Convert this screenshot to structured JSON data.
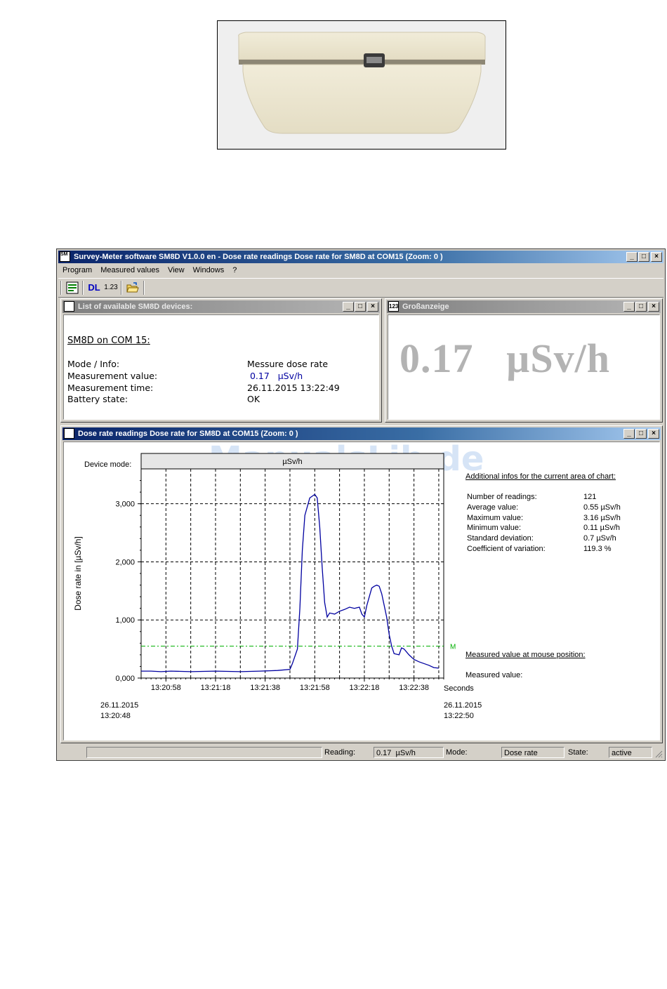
{
  "app": {
    "title": "Survey-Meter software SM8D  V1.0.0 en - Dose rate readings Dose rate for SM8D at COM15 (Zoom: 0 )",
    "icon_text": "SM 8D",
    "window_buttons": {
      "minimize": "_",
      "maximize": "□",
      "close": "×"
    }
  },
  "menu": [
    "Program",
    "Measured values",
    "View",
    "Windows",
    "?"
  ],
  "toolbar": {
    "dl_label": "DL",
    "numeric_label": "1.23"
  },
  "device_list_window": {
    "title": "List of available SM8D devices:",
    "heading": "SM8D on COM 15:",
    "rows": [
      {
        "label": "Mode / Info:",
        "value": "Messure dose rate"
      },
      {
        "label": "Measurement value:",
        "value": " 0.17   µSv/h"
      },
      {
        "label": "Measurement time:",
        "value": "26.11.2015 13:22:49"
      },
      {
        "label": "Battery state:",
        "value": "OK"
      }
    ]
  },
  "big_display_window": {
    "title": "Großanzeige",
    "icon_text": "123",
    "value": "0.17   µSv/h"
  },
  "chart_window": {
    "title": "Dose rate readings Dose rate for SM8D at COM15 (Zoom: 0 )",
    "device_mode_label": "Device mode:",
    "device_mode_value": "µSv/h",
    "watermark": "ManualsLib.de",
    "x_unit_label": "Seconds",
    "start_date": "26.11.2015",
    "start_time": "13:20:48",
    "end_date": "26.11.2015",
    "end_time": "13:22:50",
    "avg_marker": "M",
    "info_heading": "Additional infos for the current area of chart:",
    "stats": [
      {
        "label": "Number of readings:",
        "value": "121"
      },
      {
        "label": "Average value:",
        "value": "0.55 µSv/h"
      },
      {
        "label": "Maximum value:",
        "value": "3.16 µSv/h"
      },
      {
        "label": "Minimum value:",
        "value": "0.11 µSv/h"
      },
      {
        "label": "Standard deviation:",
        "value": "0.7 µSv/h"
      },
      {
        "label": "Coefficient of variation:",
        "value": "119.3 %"
      }
    ],
    "mouse_heading": "Measured value at mouse position:",
    "mouse_label": "Measured value:"
  },
  "chart_data": {
    "type": "line",
    "title": "",
    "xlabel": "Seconds",
    "ylabel": "Dose rate in [µSv/h]",
    "x_ticks": [
      "13:20:58",
      "13:21:18",
      "13:21:38",
      "13:21:58",
      "13:22:18",
      "13:22:38"
    ],
    "y_ticks": [
      "0,000",
      "1,000",
      "2,000",
      "3,000"
    ],
    "ylim": [
      0,
      3.6
    ],
    "xlim": [
      0,
      122
    ],
    "grid": true,
    "average_line": 0.55,
    "series": [
      {
        "color": "#0000a0",
        "x": [
          0,
          4,
          8,
          12,
          20,
          30,
          40,
          48,
          55,
          60,
          61,
          63,
          64,
          65,
          66,
          68,
          70,
          71,
          72,
          73,
          74,
          75,
          76,
          78,
          80,
          82,
          84,
          86,
          88,
          89,
          90,
          91,
          92,
          93,
          94,
          95,
          96,
          97,
          98,
          99,
          100,
          101,
          102,
          104,
          105,
          106,
          108,
          110,
          112,
          114,
          116,
          118,
          120
        ],
        "y": [
          0.12,
          0.12,
          0.11,
          0.12,
          0.11,
          0.12,
          0.11,
          0.12,
          0.13,
          0.15,
          0.25,
          0.5,
          1.2,
          2.2,
          2.8,
          3.1,
          3.16,
          3.1,
          2.6,
          1.9,
          1.3,
          1.05,
          1.12,
          1.1,
          1.15,
          1.18,
          1.22,
          1.2,
          1.22,
          1.1,
          1.05,
          1.25,
          1.4,
          1.55,
          1.58,
          1.6,
          1.58,
          1.45,
          1.25,
          1.05,
          0.75,
          0.55,
          0.42,
          0.4,
          0.52,
          0.5,
          0.4,
          0.32,
          0.28,
          0.25,
          0.22,
          0.18,
          0.17
        ]
      }
    ]
  },
  "statusbar": {
    "reading_label": "Reading:",
    "reading_value": "0.17  µSv/h",
    "mode_label": "Mode:",
    "mode_value": "Dose rate",
    "state_label": "State:",
    "state_value": "active"
  }
}
